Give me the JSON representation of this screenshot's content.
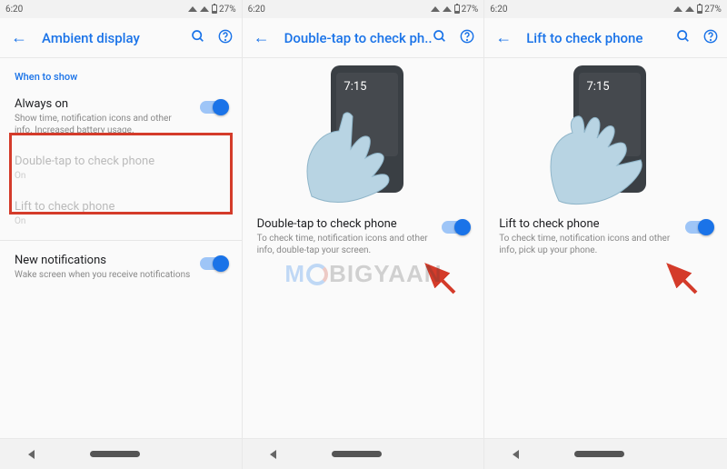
{
  "status": {
    "time": "6:20",
    "battery": "27%"
  },
  "panel1": {
    "title": "Ambient display",
    "section_header": "When to show",
    "always_on": {
      "title": "Always on",
      "subtitle": "Show time, notification icons and other info. Increased battery usage."
    },
    "double_tap": {
      "title": "Double-tap to check phone",
      "subtitle": "On"
    },
    "lift": {
      "title": "Lift to check phone",
      "subtitle": "On"
    },
    "new_notifications": {
      "title": "New notifications",
      "subtitle": "Wake screen when you receive notifications"
    }
  },
  "panel2": {
    "title": "Double-tap to check ph..",
    "phone_time": "7:15",
    "setting": {
      "title": "Double-tap to check phone",
      "subtitle": "To check time, notification icons and other info, double-tap your screen."
    }
  },
  "panel3": {
    "title": "Lift to check phone",
    "phone_time": "7:15",
    "setting": {
      "title": "Lift to check phone",
      "subtitle": "To check time, notification icons and other info, pick up your phone."
    }
  },
  "watermark": {
    "pre": "M",
    "mid": "BIGYAAN"
  }
}
